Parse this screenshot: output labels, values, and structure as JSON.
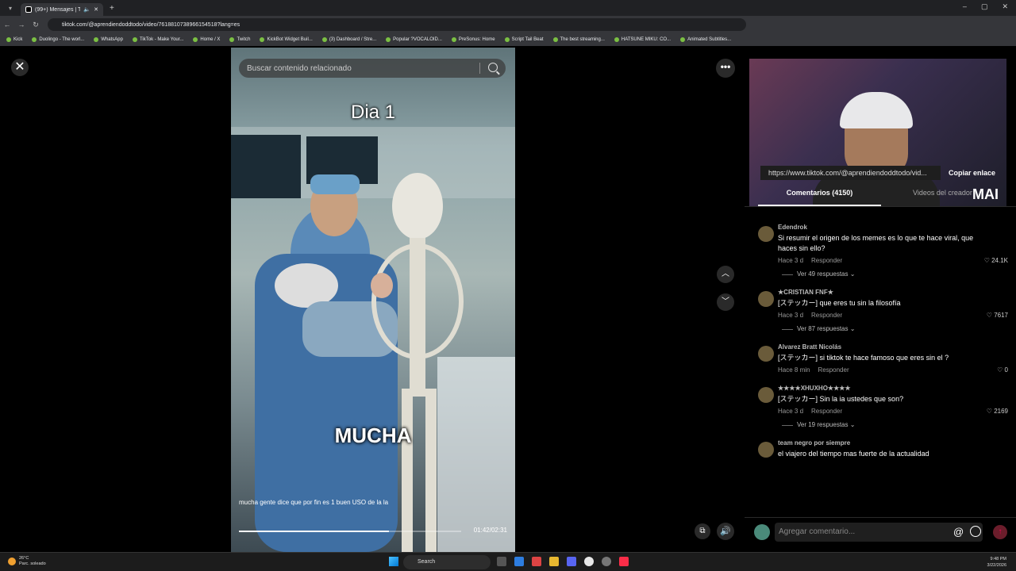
{
  "browser": {
    "tab_title": "(99+) Mensajes | TikTok",
    "url": "tiktok.com/@aprendiendoddtodo/video/7618810738966154518?lang=es",
    "bookmarks": [
      "Kick",
      "Duolingo - The worl...",
      "WhatsApp",
      "TikTok - Make Your...",
      "Home / X",
      "Twitch",
      "KickBot Widget Buil...",
      "(3) Dashboard / Stre...",
      "Popular ?VOCALOID...",
      "PreSonus: Home",
      "Script Tail Beat",
      "The best streaming...",
      "HATSUNE MIKU: CO...",
      "Animated Subtitles..."
    ]
  },
  "video": {
    "search_placeholder": "Buscar contenido relacionado",
    "caption_top": "Dia 1",
    "caption_mid": "MUCHA",
    "description": "mucha gente dice que por fin es 1 buen USO de la la",
    "time": "01:42/02:31",
    "progress": 0.675
  },
  "overlay": {
    "cam_label": "MAI"
  },
  "sidebar": {
    "link_url": "https://www.tiktok.com/@aprendiendoddtodo/vid...",
    "copy_label": "Copiar enlace",
    "tab_comments": "Comentarios (4150)",
    "tab_creator": "Videos del creador",
    "comments": [
      {
        "user": "Edendrok",
        "text": "Si resumir el origen de los memes es lo que te hace viral, que haces sin ello?",
        "time": "Hace 3 d",
        "reply": "Responder",
        "likes": "24.1K",
        "replies": "Ver 49 respuestas"
      },
      {
        "user": "★CRISTIAN FNF★",
        "text": "[ステッカー] que eres tu sin la filosofía",
        "time": "Hace 3 d",
        "reply": "Responder",
        "likes": "7617",
        "replies": "Ver 87 respuestas"
      },
      {
        "user": "Alvarez Bratt Nicolás",
        "text": "[ステッカー] si tiktok te hace famoso que eres sin el ?",
        "time": "Hace 8 min",
        "reply": "Responder",
        "likes": "0",
        "replies": ""
      },
      {
        "user": "★★★★XHUXHO★★★★",
        "text": "[ステッカー] Sin la ia ustedes que son?",
        "time": "Hace 3 d",
        "reply": "Responder",
        "likes": "2169",
        "replies": "Ver 19 respuestas"
      },
      {
        "user": "team negro por siempre",
        "text": "el viajero del tiempo mas fuerte de la actualidad",
        "time": "",
        "reply": "",
        "likes": "",
        "replies": ""
      }
    ],
    "comment_placeholder": "Agregar comentario..."
  },
  "taskbar": {
    "temp": "26°C",
    "weather": "Parc. soleado",
    "search": "Search",
    "time": "9:48 PM",
    "date": "3/22/2026"
  },
  "colors": {
    "accent": "#fe2c55",
    "bg": "#000000"
  }
}
